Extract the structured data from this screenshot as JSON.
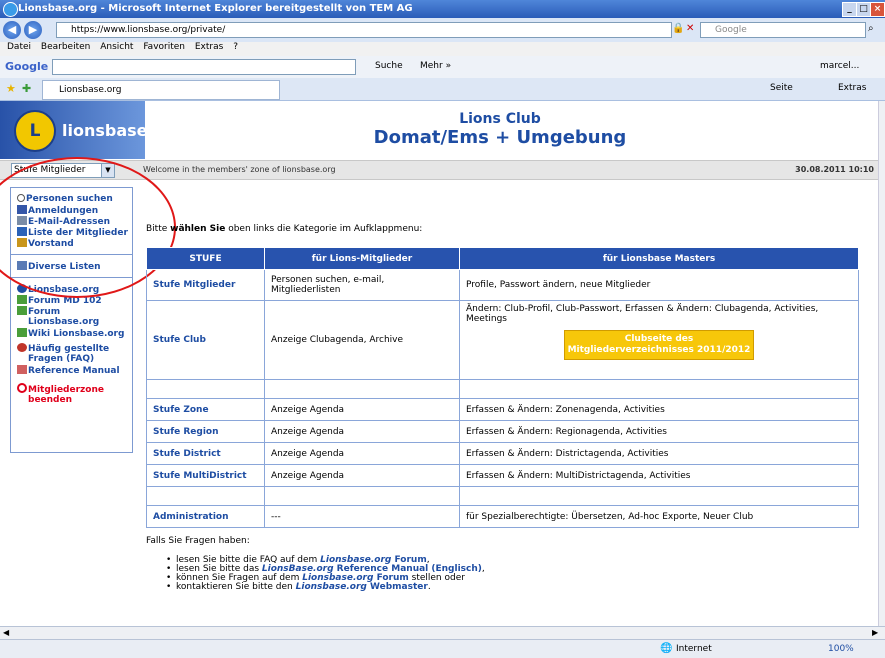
{
  "window": {
    "title": "Lionsbase.org - Microsoft Internet Explorer bereitgestellt von TEM AG"
  },
  "address_bar": {
    "url": "https://www.lionsbase.org/private/",
    "search_placeholder": "Google"
  },
  "menu": [
    "Datei",
    "Bearbeiten",
    "Ansicht",
    "Favoriten",
    "Extras",
    "?"
  ],
  "google_toolbar": {
    "logo": "Google",
    "search_label": "Suche",
    "more_label": "Mehr »",
    "user": "marcel..."
  },
  "tab": {
    "label": "Lionsbase.org"
  },
  "ie_toolbar": {
    "page_label": "Seite",
    "extras_label": "Extras"
  },
  "header": {
    "logo_text": "lionsbase.org",
    "logo_emblem": "L",
    "club_line1": "Lions Club",
    "club_line2": "Domat/Ems + Umgebung"
  },
  "infobar": {
    "level_select": "Stufe Mitglieder",
    "welcome": "Welcome in the members' zone of lionsbase.org",
    "datetime": "30.08.2011 10:10"
  },
  "sidebar": {
    "personen_suchen": "Personen suchen",
    "anmeldungen": "Anmeldungen",
    "email_adressen": "E-Mail-Adressen",
    "liste_mitglieder": "Liste der Mitglieder",
    "vorstand": "Vorstand",
    "diverse_listen": "Diverse Listen",
    "lionsbase": "Lionsbase.org",
    "forum_md": "Forum MD 102",
    "forum_lb_1": "Forum",
    "forum_lb_2": "Lionsbase.org",
    "wiki": "Wiki Lionsbase.org",
    "faq_1": "Häufig gestellte",
    "faq_2": "Fragen (FAQ)",
    "reference": "Reference Manual",
    "logout_1": "Mitgliederzone",
    "logout_2": "beenden"
  },
  "main": {
    "prompt_pre": "Bitte ",
    "prompt_bold": "wählen Sie",
    "prompt_post": " oben links die Kategorie im Aufklappmenu:",
    "table": {
      "headers": [
        "STUFE",
        "für Lions-Mitglieder",
        "für Lionsbase Masters"
      ],
      "rows": [
        {
          "level": "Stufe Mitglieder",
          "members": "Personen suchen, e-mail, Mitgliederlisten",
          "masters": "Profile, Passwort ändern, neue Mitglieder"
        },
        {
          "level": "Stufe Club",
          "members": "Anzeige Clubagenda, Archive",
          "masters": "Ändern: Club-Profil, Club-Passwort, Erfassen & Ändern: Clubagenda, Activities, Meetings",
          "button_1": "Clubseite des",
          "button_2": "Mitgliederverzeichnisses 2011/2012"
        },
        {
          "level": "Stufe Zone",
          "members": "Anzeige Agenda",
          "masters": "Erfassen & Ändern: Zonenagenda, Activities"
        },
        {
          "level": "Stufe Region",
          "members": "Anzeige Agenda",
          "masters": "Erfassen & Ändern: Regionagenda, Activities"
        },
        {
          "level": "Stufe District",
          "members": "Anzeige Agenda",
          "masters": "Erfassen & Ändern: Districtagenda, Activities"
        },
        {
          "level": "Stufe MultiDistrict",
          "members": "Anzeige Agenda",
          "masters": "Erfassen & Ändern: MultiDistrictagenda, Activities"
        },
        {
          "level": "Administration",
          "members": "---",
          "masters": "für Spezialberechtigte: Übersetzen, Ad-hoc Exporte, Neuer Club"
        }
      ]
    }
  },
  "faq": {
    "intro": "Falls Sie Fragen haben:",
    "i1_a": "lesen Sie bitte die FAQ auf dem ",
    "i1_b": "Lionsbase.org",
    "i1_c": " Forum",
    "i2_a": "lesen Sie bitte das ",
    "i2_b": "LionsBase.org",
    "i2_c": " Reference Manual (Englisch)",
    "i3_a": "können Sie Fragen auf dem ",
    "i3_b": "Lionsbase.org",
    "i3_c": " Forum",
    "i3_d": " stellen oder",
    "i4_a": "kontaktieren Sie bitte den ",
    "i4_b": "Lionsbase.org",
    "i4_c": " Webmaster"
  },
  "status": {
    "zone": "Internet",
    "zoom": "100%"
  },
  "colors": {
    "accent": "#1e4da3",
    "header_blue": "#2853ae",
    "button_yellow": "#f7c70a",
    "circle_red": "#e01818"
  }
}
